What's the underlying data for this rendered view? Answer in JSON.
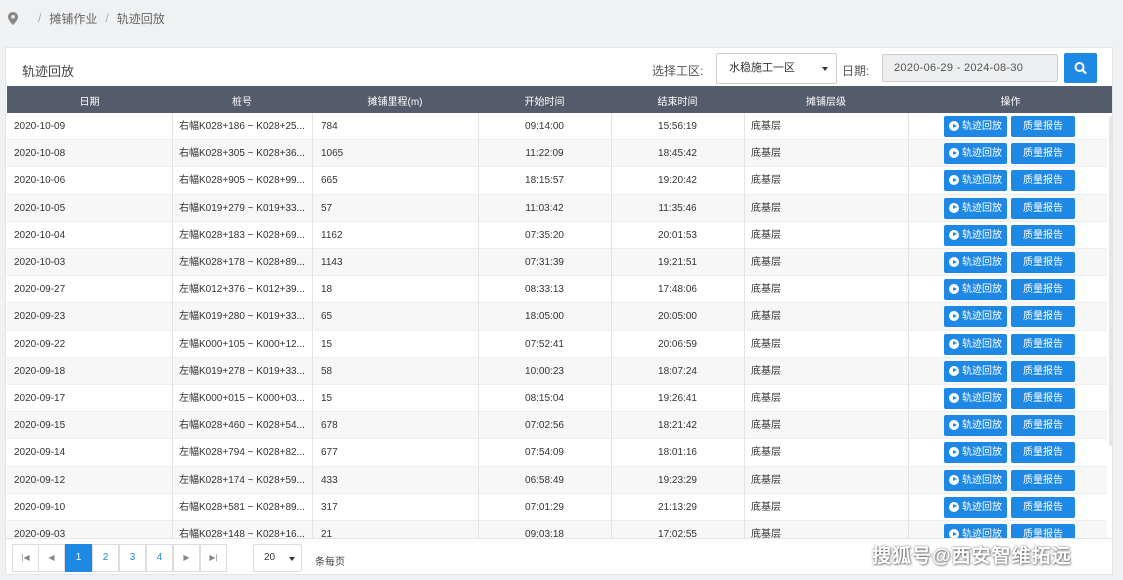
{
  "breadcrumb": [
    "摊铺作业",
    "轨迹回放"
  ],
  "panel_title": "轨迹回放",
  "filters": {
    "area_label": "选择工区:",
    "area_value": "水稳施工一区",
    "date_label": "日期:",
    "date_value": "2020-06-29 - 2024-08-30"
  },
  "columns": [
    "日期",
    "桩号",
    "摊铺里程(m)",
    "开始时间",
    "结束时间",
    "摊铺层级",
    "操作"
  ],
  "action_labels": {
    "play": "轨迹回放",
    "report": "质量报告"
  },
  "rows": [
    {
      "date": "2020-10-09",
      "stake": "右幅K028+186 ~ K028+25...",
      "mileage": "784",
      "start": "09:14:00",
      "end": "15:56:19",
      "layer": "底基层"
    },
    {
      "date": "2020-10-08",
      "stake": "右幅K028+305 ~ K028+36...",
      "mileage": "1065",
      "start": "11:22:09",
      "end": "18:45:42",
      "layer": "底基层"
    },
    {
      "date": "2020-10-06",
      "stake": "右幅K028+905 ~ K028+99...",
      "mileage": "665",
      "start": "18:15:57",
      "end": "19:20:42",
      "layer": "底基层"
    },
    {
      "date": "2020-10-05",
      "stake": "右幅K019+279 ~ K019+33...",
      "mileage": "57",
      "start": "11:03:42",
      "end": "11:35:46",
      "layer": "底基层"
    },
    {
      "date": "2020-10-04",
      "stake": "左幅K028+183 ~ K028+69...",
      "mileage": "1162",
      "start": "07:35:20",
      "end": "20:01:53",
      "layer": "底基层"
    },
    {
      "date": "2020-10-03",
      "stake": "左幅K028+178 ~ K028+89...",
      "mileage": "1143",
      "start": "07:31:39",
      "end": "19:21:51",
      "layer": "底基层"
    },
    {
      "date": "2020-09-27",
      "stake": "左幅K012+376 ~ K012+39...",
      "mileage": "18",
      "start": "08:33:13",
      "end": "17:48:06",
      "layer": "底基层"
    },
    {
      "date": "2020-09-23",
      "stake": "左幅K019+280 ~ K019+33...",
      "mileage": "65",
      "start": "18:05:00",
      "end": "20:05:00",
      "layer": "底基层"
    },
    {
      "date": "2020-09-22",
      "stake": "左幅K000+105 ~ K000+12...",
      "mileage": "15",
      "start": "07:52:41",
      "end": "20:06:59",
      "layer": "底基层"
    },
    {
      "date": "2020-09-18",
      "stake": "左幅K019+278 ~ K019+33...",
      "mileage": "58",
      "start": "10:00:23",
      "end": "18:07:24",
      "layer": "底基层"
    },
    {
      "date": "2020-09-17",
      "stake": "左幅K000+015 ~ K000+03...",
      "mileage": "15",
      "start": "08:15:04",
      "end": "19:26:41",
      "layer": "底基层"
    },
    {
      "date": "2020-09-15",
      "stake": "右幅K028+460 ~ K028+54...",
      "mileage": "678",
      "start": "07:02:56",
      "end": "18:21:42",
      "layer": "底基层"
    },
    {
      "date": "2020-09-14",
      "stake": "左幅K028+794 ~ K028+82...",
      "mileage": "677",
      "start": "07:54:09",
      "end": "18:01:16",
      "layer": "底基层"
    },
    {
      "date": "2020-09-12",
      "stake": "左幅K028+174 ~ K028+59...",
      "mileage": "433",
      "start": "06:58:49",
      "end": "19:23:29",
      "layer": "底基层"
    },
    {
      "date": "2020-09-10",
      "stake": "右幅K028+581 ~ K028+89...",
      "mileage": "317",
      "start": "07:01:29",
      "end": "21:13:29",
      "layer": "底基层"
    },
    {
      "date": "2020-09-03",
      "stake": "右幅K028+148 ~ K028+16...",
      "mileage": "21",
      "start": "09:03:18",
      "end": "17:02:55",
      "layer": "底基层"
    }
  ],
  "pagination": {
    "pages": [
      "1",
      "2",
      "3",
      "4"
    ],
    "current": "1",
    "page_size": "20",
    "per_page_label": "条每页"
  },
  "watermark": "搜狐号@西安智维拓远",
  "colors": {
    "header_bg": "#545c6b",
    "primary": "#1e88e5",
    "scroll_thumb": "#3cb371"
  }
}
